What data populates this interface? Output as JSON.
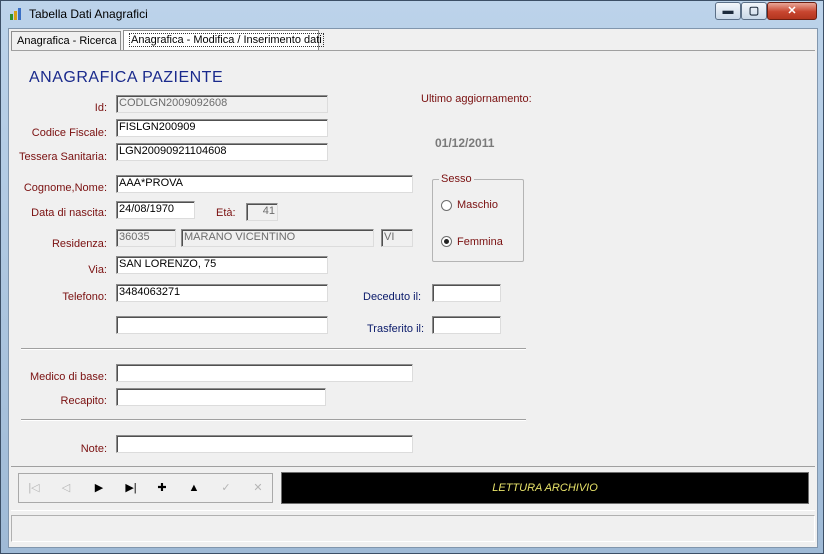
{
  "window": {
    "title": "Tabella Dati Anagrafici",
    "minimize": "▬",
    "maximize": "▢",
    "close": "✕"
  },
  "tabs": [
    {
      "label": "Anagrafica - Ricerca"
    },
    {
      "label": "Anagrafica - Modifica / Inserimento dati"
    }
  ],
  "form": {
    "heading": "ANAGRAFICA PAZIENTE",
    "last_update_label": "Ultimo aggiornamento:",
    "last_update_value": "01/12/2011",
    "id": {
      "label": "Id:",
      "value": "CODLGN2009092608"
    },
    "codice_fiscale": {
      "label": "Codice Fiscale:",
      "value": "FISLGN200909"
    },
    "tessera_sanitaria": {
      "label": "Tessera Sanitaria:",
      "value": "LGN20090921104608"
    },
    "cognome_nome": {
      "label": "Cognome,Nome:",
      "value": "AAA*PROVA"
    },
    "data_nascita": {
      "label": "Data di nascita:",
      "value": "24/08/1970"
    },
    "eta": {
      "label": "Età:",
      "value": "41"
    },
    "residenza": {
      "label": "Residenza:",
      "cap": "36035",
      "comune": "MARANO VICENTINO",
      "provincia": "VI"
    },
    "via": {
      "label": "Via:",
      "value": "SAN LORENZO, 75"
    },
    "telefono": {
      "label": "Telefono:",
      "value": "3484063271",
      "value2": ""
    },
    "deceduto": {
      "label": "Deceduto il:",
      "value": ""
    },
    "trasferito": {
      "label": "Trasferito il:",
      "value": ""
    },
    "sesso": {
      "label": "Sesso",
      "options": [
        "Maschio",
        "Femmina"
      ],
      "selected": "Femmina"
    },
    "medico_base": {
      "label": "Medico di base:",
      "value": ""
    },
    "recapito": {
      "label": "Recapito:",
      "value": ""
    },
    "note": {
      "label": "Note:",
      "value": ""
    }
  },
  "navigator": {
    "buttons": [
      {
        "name": "first-record-button",
        "glyph": "|◁",
        "enabled": false
      },
      {
        "name": "prev-record-button",
        "glyph": "◁",
        "enabled": false
      },
      {
        "name": "next-record-button",
        "glyph": "▶",
        "enabled": true
      },
      {
        "name": "last-record-button",
        "glyph": "▶|",
        "enabled": true
      },
      {
        "name": "add-record-button",
        "glyph": "✚",
        "enabled": true
      },
      {
        "name": "edit-record-button",
        "glyph": "▲",
        "enabled": true
      },
      {
        "name": "post-record-button",
        "glyph": "✓",
        "enabled": false
      },
      {
        "name": "cancel-record-button",
        "glyph": "✕",
        "enabled": false
      }
    ],
    "status": "LETTURA ARCHIVIO"
  }
}
